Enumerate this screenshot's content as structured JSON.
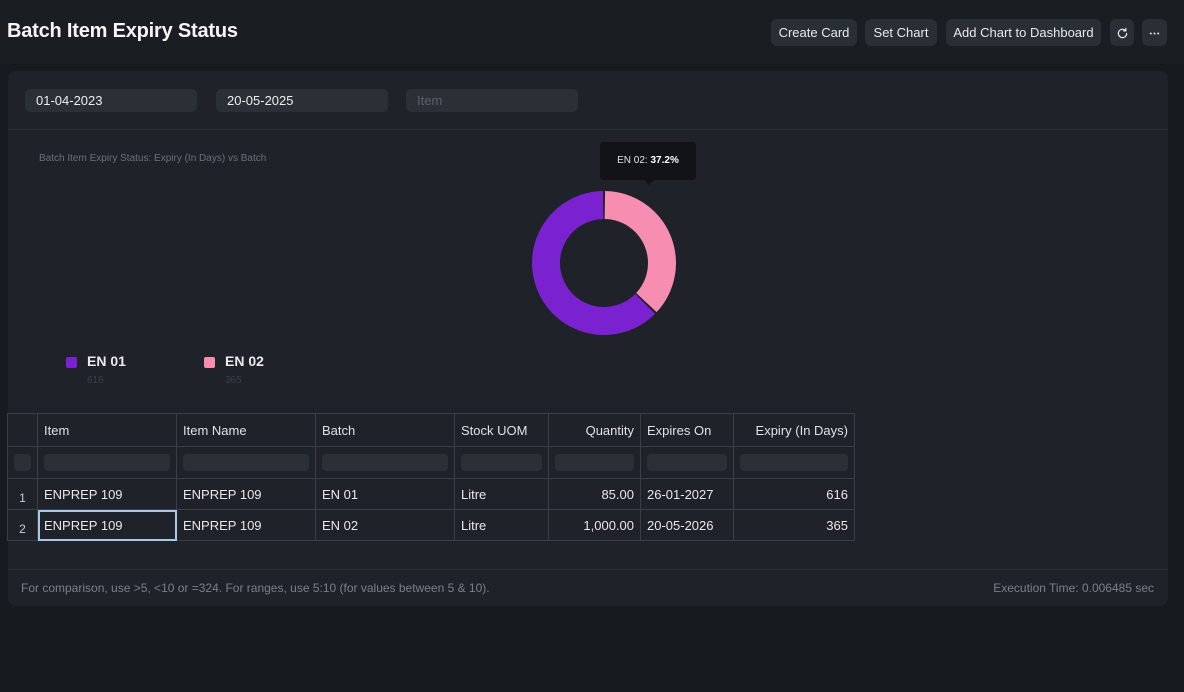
{
  "header": {
    "title": "Batch Item Expiry Status",
    "buttons": {
      "create_card": "Create Card",
      "set_chart": "Set Chart",
      "add_to_dashboard": "Add Chart to Dashboard",
      "refresh_icon": "refresh-icon",
      "more_icon": "more-icon"
    }
  },
  "filters": {
    "from_date": "01-04-2023",
    "to_date": "20-05-2025",
    "item_placeholder": "Item"
  },
  "chart_data": {
    "type": "pie",
    "title": "Batch Item Expiry Status: Expiry (In Days) vs Batch",
    "categories": [
      "EN 01",
      "EN 02"
    ],
    "values": [
      616,
      365
    ],
    "colors": [
      "#7b22d0",
      "#f78db0"
    ],
    "tooltip": {
      "label": "EN 02:",
      "value": "37.2%"
    },
    "legend": [
      {
        "label": "EN 01",
        "value": "616"
      },
      {
        "label": "EN 02",
        "value": "365"
      }
    ]
  },
  "table": {
    "columns": [
      "Item",
      "Item Name",
      "Batch",
      "Stock UOM",
      "Quantity",
      "Expires On",
      "Expiry (In Days)"
    ],
    "rows": [
      {
        "num": "1",
        "item": "ENPREP 109",
        "item_name": "ENPREP 109",
        "batch": "EN 01",
        "uom": "Litre",
        "quantity": "85.00",
        "expires_on": "26-01-2027",
        "expiry_days": "616"
      },
      {
        "num": "2",
        "item": "ENPREP 109",
        "item_name": "ENPREP 109",
        "batch": "EN 02",
        "uom": "Litre",
        "quantity": "1,000.00",
        "expires_on": "20-05-2026",
        "expiry_days": "365"
      }
    ]
  },
  "footer": {
    "note": "For comparison, use >5, <10 or =324. For ranges, use 5:10 (for values between 5 & 10).",
    "execution_time": "Execution Time: 0.006485 sec"
  }
}
